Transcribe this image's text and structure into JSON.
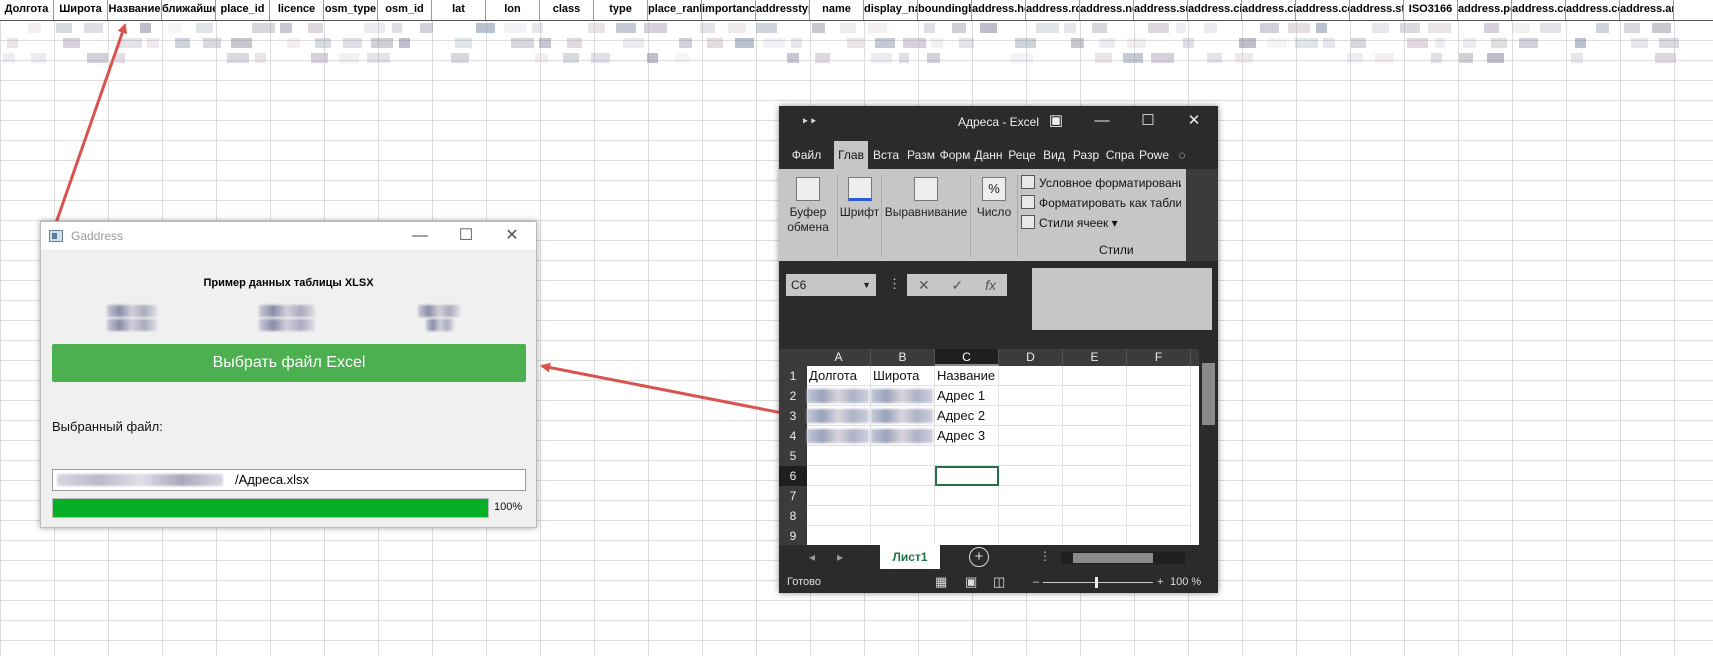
{
  "background_sheet": {
    "headers": [
      "Долгота",
      "Широта",
      "Название",
      "ближайшее м",
      "place_id",
      "licence",
      "osm_type",
      "osm_id",
      "lat",
      "lon",
      "class",
      "type",
      "place_rank",
      "importance",
      "addresstype",
      "name",
      "display_name",
      "boundingbox",
      "address.house_number",
      "address.road",
      "address.neighbourhood",
      "address.suburb",
      "address.city_district",
      "address.city",
      "address.county",
      "address.state",
      "ISO3166",
      "address.postcode",
      "address.country",
      "address.country_code",
      "address.amenity"
    ]
  },
  "gaddress": {
    "title": "Gaddress",
    "sample_title": "Пример данных таблицы XLSX",
    "select_button": "Выбрать файл Excel",
    "selected_label": "Выбранный файл:",
    "file_path_suffix": "/Адреса.xlsx",
    "progress_percent": 100,
    "progress_text": "100%",
    "icons": {
      "minimize": "minimize-icon",
      "maximize": "maximize-icon",
      "close": "close-icon"
    }
  },
  "excel": {
    "window_title": "Адреса - Excel",
    "tabs": [
      "Файл",
      "Глав",
      "Вста",
      "Разм",
      "Форм",
      "Данн",
      "Реце",
      "Вид",
      "Разр",
      "Спра",
      "Powe"
    ],
    "active_tab": "Глав",
    "ribbon": {
      "clipboard": "Буфер обмена",
      "font": "Шрифт",
      "alignment": "Выравнивание",
      "number": "Число",
      "styles_items": [
        "Условное форматирование",
        "Форматировать как таблицу",
        "Стили ячеек"
      ],
      "styles_title": "Стили"
    },
    "name_box": "C6",
    "columns": [
      "A",
      "B",
      "C",
      "D",
      "E",
      "F"
    ],
    "selected_column": "C",
    "rows": [
      {
        "num": "1",
        "cells": [
          "Долгота",
          "Широта",
          "Название",
          "",
          "",
          ""
        ]
      },
      {
        "num": "2",
        "cells": [
          "",
          "",
          "Адрес 1",
          "",
          "",
          ""
        ]
      },
      {
        "num": "3",
        "cells": [
          "",
          "",
          "Адрес 2",
          "",
          "",
          ""
        ]
      },
      {
        "num": "4",
        "cells": [
          "",
          "",
          "Адрес 3",
          "",
          "",
          ""
        ]
      },
      {
        "num": "5",
        "cells": [
          "",
          "",
          "",
          "",
          "",
          ""
        ]
      },
      {
        "num": "6",
        "cells": [
          "",
          "",
          "",
          "",
          "",
          ""
        ]
      },
      {
        "num": "7",
        "cells": [
          "",
          "",
          "",
          "",
          "",
          ""
        ]
      },
      {
        "num": "8",
        "cells": [
          "",
          "",
          "",
          "",
          "",
          ""
        ]
      },
      {
        "num": "9",
        "cells": [
          "",
          "",
          "",
          "",
          "",
          ""
        ]
      }
    ],
    "selected_row": "6",
    "sheet_tab": "Лист1",
    "status_ready": "Готово",
    "zoom": "100 %"
  }
}
